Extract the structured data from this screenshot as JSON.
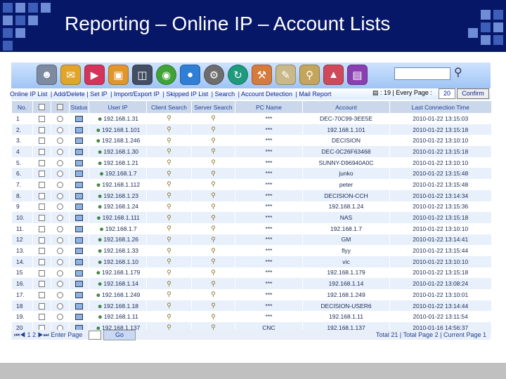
{
  "slide": {
    "title": "Reporting – Online IP – Account Lists"
  },
  "toolbar": {
    "icons": [
      "users-icon",
      "mail-icon",
      "player-icon",
      "folder-icon",
      "monitor-icon",
      "globe-icon",
      "network-icon",
      "gear-icon",
      "refresh-icon",
      "wrench-icon",
      "edit-icon",
      "search-tool-icon",
      "chart-icon",
      "report-icon"
    ],
    "search_placeholder": ""
  },
  "menu": {
    "links": [
      "Online IP List",
      "| Add/Delete | Set IP",
      "| Import/Export IP",
      "| Skipped IP List",
      "| Search",
      "| Account Detection",
      "| Mail Report"
    ],
    "every_page_label": "▤ : 19 | Every Page :",
    "page_size": "20",
    "confirm_label": "Confirm"
  },
  "table": {
    "headers": [
      "No.",
      "",
      "",
      "Status",
      "User IP",
      "Client Search",
      "Server Search",
      "PC Name",
      "Account",
      "Last Connection Time"
    ],
    "rows": [
      {
        "no": "1",
        "ip": "192.168.1.31",
        "pc": "***",
        "account": "DEC-70C99-3EE5E",
        "time": "2010-01-22 13:15:03"
      },
      {
        "no": "2.",
        "ip": "192.168.1.101",
        "pc": "***",
        "account": "192.168.1.101",
        "time": "2010-01-22 13:15:18"
      },
      {
        "no": "3.",
        "ip": "192.168.1.246",
        "pc": "***",
        "account": "DECISION",
        "time": "2010-01-22 13:10:10"
      },
      {
        "no": "4",
        "ip": "192.168.1.30",
        "pc": "***",
        "account": "DEC-0C26F63468",
        "time": "2010-01-22 13:15:18"
      },
      {
        "no": "5.",
        "ip": "192.168.1.21",
        "pc": "***",
        "account": "SUNNY-D96940A0C",
        "time": "2010-01-22 13:10:10"
      },
      {
        "no": "6.",
        "ip": "192.168.1.7",
        "pc": "***",
        "account": "junko",
        "time": "2010-01-22 13:15:48"
      },
      {
        "no": "7.",
        "ip": "192.168.1.112",
        "pc": "***",
        "account": "peter",
        "time": "2010-01-22 13:15:48"
      },
      {
        "no": "8.",
        "ip": "192.168.1.23",
        "pc": "***",
        "account": "DECISION-CCH",
        "time": "2010-01-22 13:14:34"
      },
      {
        "no": "9",
        "ip": "192.168.1.24",
        "pc": "***",
        "account": "192.168.1.24",
        "time": "2010-01-22 13:15:36"
      },
      {
        "no": "10.",
        "ip": "192.168.1.111",
        "pc": "***",
        "account": "NAS",
        "time": "2010-01-22 13:15:18"
      },
      {
        "no": "11.",
        "ip": "192.168.1.7",
        "pc": "***",
        "account": "192.168.1.7",
        "time": "2010-01-22 13:10:10"
      },
      {
        "no": "12",
        "ip": "192.168.1.26",
        "pc": "***",
        "account": "GM",
        "time": "2010-01-22 13:14:41"
      },
      {
        "no": "13.",
        "ip": "192.168.1.33",
        "pc": "***",
        "account": "flyy",
        "time": "2010-01-22 13:15:44"
      },
      {
        "no": "14.",
        "ip": "192.168.1.10",
        "pc": "***",
        "account": "vic",
        "time": "2010-01-22 13:10:10"
      },
      {
        "no": "15",
        "ip": "192.168.1.179",
        "pc": "***",
        "account": "192.168.1.179",
        "time": "2010-01-22 13:15:18"
      },
      {
        "no": "16.",
        "ip": "192.168.1.14",
        "pc": "***",
        "account": "192.168.1.14",
        "time": "2010-01-22 13:08:24"
      },
      {
        "no": "17.",
        "ip": "192.168.1.249",
        "pc": "***",
        "account": "192.168.1.249",
        "time": "2010-01-22 13:10:01"
      },
      {
        "no": "18",
        "ip": "192.168.1.18",
        "pc": "***",
        "account": "DECISION-USER6",
        "time": "2010-01-22 13:14:44"
      },
      {
        "no": "19.",
        "ip": "192.168.1.11",
        "pc": "***",
        "account": "192.168.1.11",
        "time": "2010-01-22 13:11:54"
      },
      {
        "no": "20",
        "ip": "192.168.1.137",
        "pc": "CNC",
        "account": "192.168.1.137",
        "time": "2010-01-16 14:56:37"
      }
    ]
  },
  "footer": {
    "pager_label": "⏮◀ 1 2 ▶⏭ Enter Page",
    "go_label": "Go",
    "totals": "Total 21 | Total Page 2 | Current Page 1"
  },
  "colors": {
    "header_bg": "#071768",
    "accent": "#3c5db8"
  }
}
